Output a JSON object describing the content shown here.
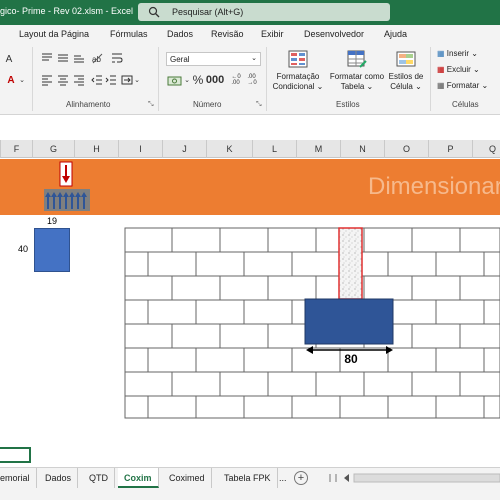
{
  "title_bar": {
    "doc_title": "gico- Prime - Rev 02.xlsm  -  Excel",
    "search_placeholder": "Pesquisar (Alt+G)"
  },
  "ribbon": {
    "tabs": [
      "Layout da Página",
      "Fórmulas",
      "Dados",
      "Revisão",
      "Exibir",
      "Desenvolvedor",
      "Ajuda"
    ],
    "number_format": "Geral",
    "buttons": {
      "conditional_formatting": [
        "Formatação",
        "Condicional"
      ],
      "format_as_table": [
        "Formatar como",
        "Tabela"
      ],
      "cell_styles": [
        "Estilos de",
        "Célula"
      ],
      "insert": "Inserir",
      "delete": "Excluir",
      "format": "Formatar"
    },
    "group_labels": {
      "alignment": "Alinhamento",
      "number": "Número",
      "styles": "Estilos",
      "cells": "Células"
    },
    "icons": [
      "align-top-icon",
      "align-middle-icon",
      "align-bottom-icon",
      "orientation-icon",
      "wrap-text-icon",
      "align-left-icon",
      "align-center-icon",
      "align-right-icon",
      "decrease-indent-icon",
      "increase-indent-icon",
      "merge-cells-icon",
      "currency-icon",
      "percent-icon",
      "comma-style-icon",
      "increase-decimal-icon",
      "decrease-decimal-icon",
      "font-color-icon"
    ]
  },
  "columns": [
    "F",
    "G",
    "H",
    "I",
    "J",
    "K",
    "L",
    "M",
    "N",
    "O",
    "P",
    "Q"
  ],
  "banner": {
    "title": "Dimensionar",
    "color": "#ed7d31"
  },
  "drawing": {
    "dim_19": "19",
    "dim_40": "40",
    "dim_80": "80"
  },
  "sheets": {
    "tabs": [
      "emorial",
      "Dados",
      "QTD",
      "Coxim",
      "Coximed",
      "Tabela FPK"
    ],
    "active": "Coxim",
    "more": "..."
  },
  "colors": {
    "excel_green": "#217346",
    "bearing_blue": "#2f5597",
    "column_red": "#e03030"
  }
}
